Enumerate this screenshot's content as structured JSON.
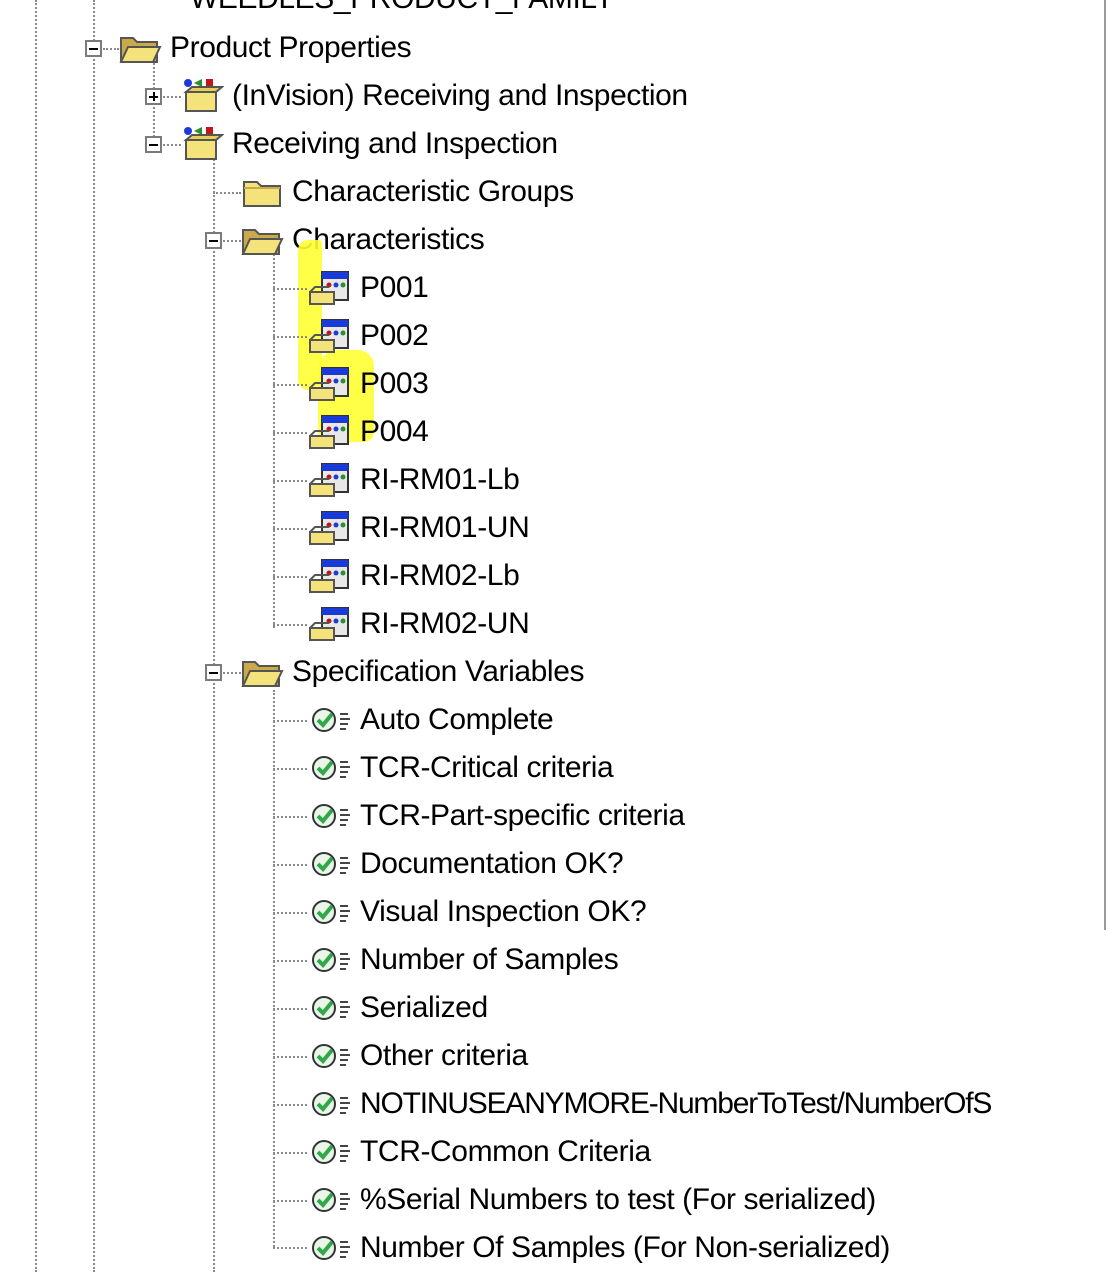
{
  "tree": {
    "top_partial_label": "WEEDLES_PRODUCT_FAMILY",
    "product_properties": {
      "label": "Product Properties",
      "icon": "open-folder-icon"
    },
    "invision_receiving": {
      "label": "(InVision) Receiving and Inspection",
      "icon": "property-group-icon"
    },
    "receiving": {
      "label": "Receiving and Inspection",
      "icon": "property-group-icon"
    },
    "characteristic_groups": {
      "label": "Characteristic Groups",
      "icon": "folder-icon"
    },
    "characteristics": {
      "label": "Characteristics",
      "icon": "open-folder-icon",
      "items": [
        "P001",
        "P002",
        "P003",
        "P004",
        "RI-RM01-Lb",
        "RI-RM01-UN",
        "RI-RM02-Lb",
        "RI-RM02-UN"
      ]
    },
    "specification_variables": {
      "label": "Specification Variables",
      "icon": "open-folder-icon",
      "items": [
        "Auto Complete",
        "TCR-Critical criteria",
        "TCR-Part-specific criteria",
        "Documentation OK?",
        "Visual Inspection OK?",
        "Number of Samples",
        "Serialized",
        "Other criteria",
        "NOTINUSEANYMORE-NumberToTest/NumberOfS",
        "TCR-Common Criteria",
        "%Serial Numbers to test (For serialized)",
        "Number Of Samples (For Non-serialized)"
      ]
    }
  },
  "colors": {
    "highlight": "#ffff33",
    "folder": "#f4e27a",
    "check": "#2fa84a"
  }
}
